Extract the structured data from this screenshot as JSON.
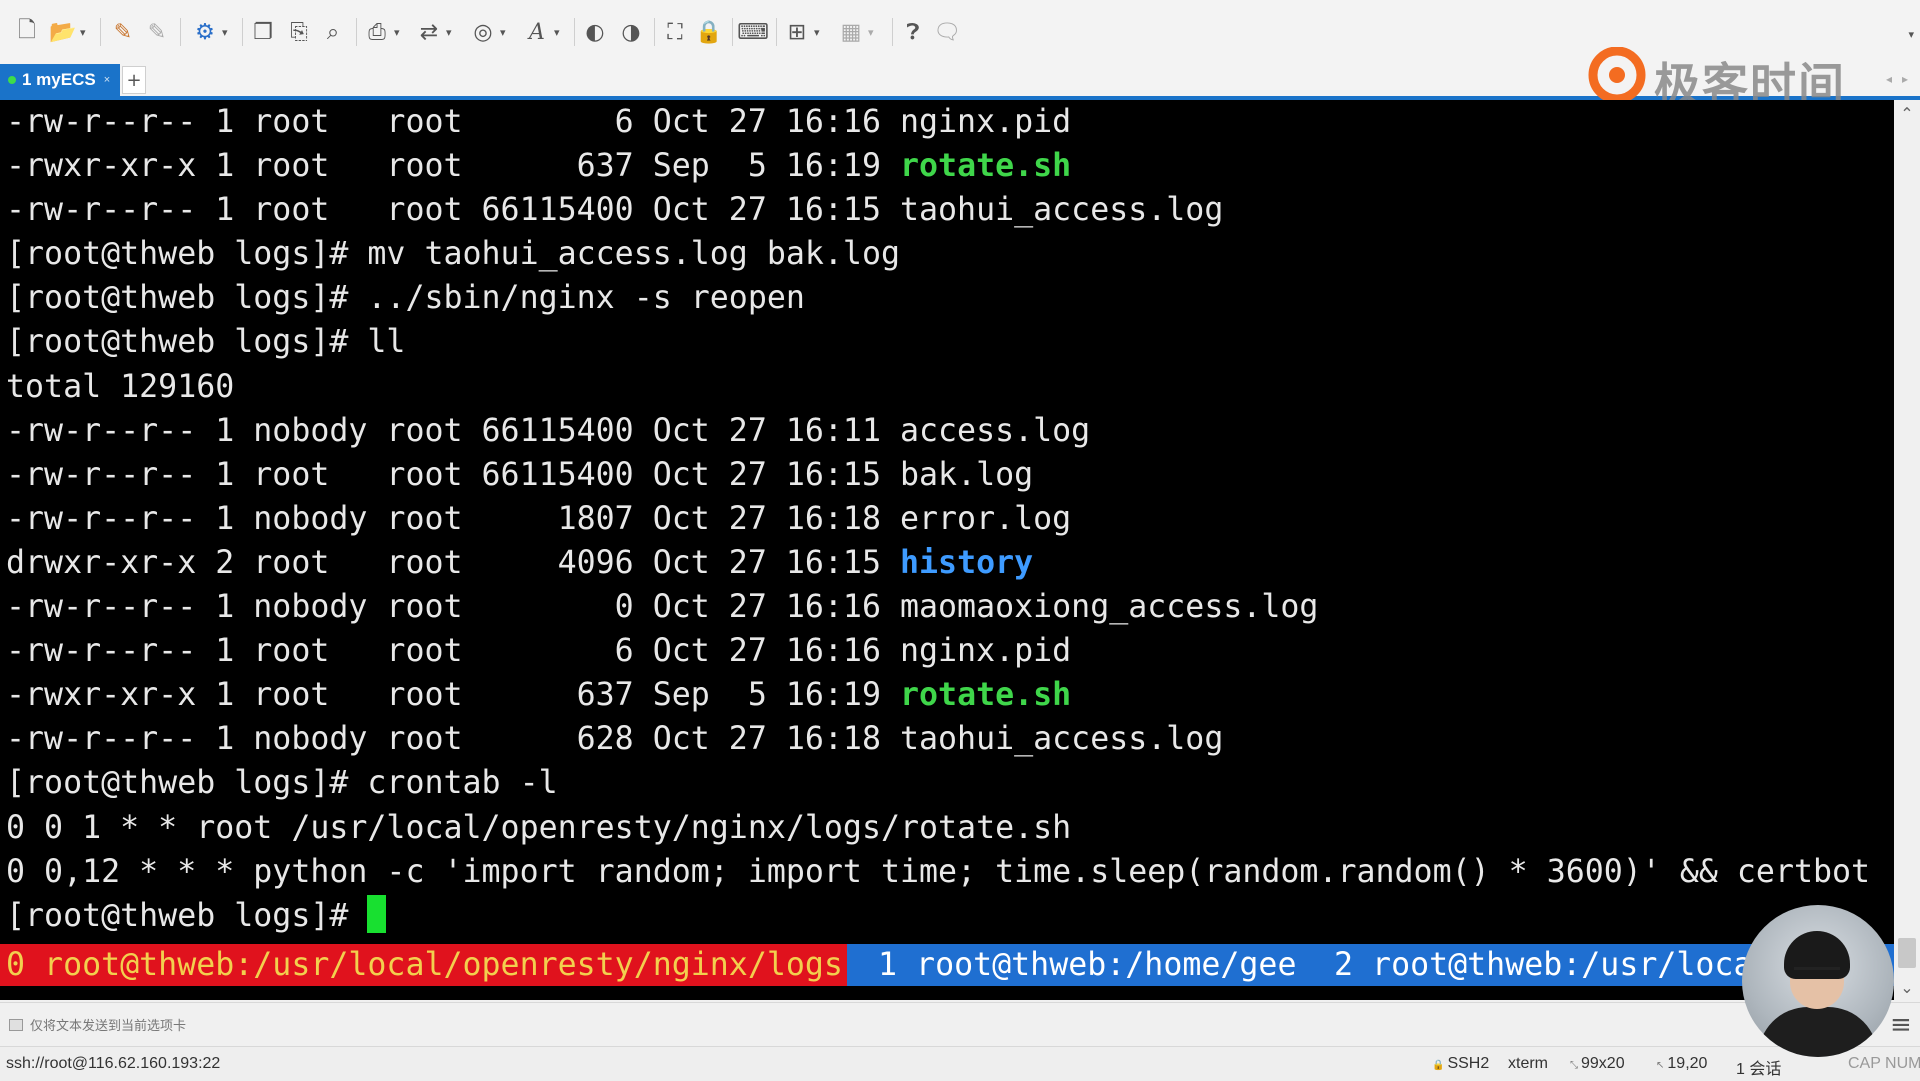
{
  "toolbar": {
    "icons": [
      "new-session-icon",
      "open-folder-icon",
      "connect-icon",
      "disconnect-icon",
      "session-properties-icon",
      "copy-icon",
      "paste-icon",
      "find-icon",
      "print-icon",
      "transfer-icon",
      "globe-icon",
      "font-icon",
      "color-scheme-icon",
      "script-icon",
      "fullscreen-icon",
      "lock-icon",
      "keyboard-icon",
      "new-tab-icon",
      "layout-icon",
      "help-icon",
      "message-icon"
    ]
  },
  "tabs": {
    "active_label": "1 myECS",
    "close_glyph": "×",
    "add_glyph": "+"
  },
  "logo": {
    "text": "极客时间"
  },
  "terminal": {
    "lines": [
      [
        {
          "t": "-rw-r--r-- 1 root   root        6 Oct 27 16:16 nginx.pid"
        }
      ],
      [
        {
          "t": "-rwxr-xr-x 1 root   root      637 Sep  5 16:19 "
        },
        {
          "t": "rotate.sh",
          "c": "green"
        }
      ],
      [
        {
          "t": "-rw-r--r-- 1 root   root 66115400 Oct 27 16:15 taohui_access.log"
        }
      ],
      [
        {
          "t": "[root@thweb logs]# mv taohui_access.log bak.log"
        }
      ],
      [
        {
          "t": "[root@thweb logs]# ../sbin/nginx -s reopen"
        }
      ],
      [
        {
          "t": "[root@thweb logs]# ll"
        }
      ],
      [
        {
          "t": "total 129160"
        }
      ],
      [
        {
          "t": "-rw-r--r-- 1 nobody root 66115400 Oct 27 16:11 access.log"
        }
      ],
      [
        {
          "t": "-rw-r--r-- 1 root   root 66115400 Oct 27 16:15 bak.log"
        }
      ],
      [
        {
          "t": "-rw-r--r-- 1 nobody root     1807 Oct 27 16:18 error.log"
        }
      ],
      [
        {
          "t": "drwxr-xr-x 2 root   root     4096 Oct 27 16:15 "
        },
        {
          "t": "history",
          "c": "blue"
        }
      ],
      [
        {
          "t": "-rw-r--r-- 1 nobody root        0 Oct 27 16:16 maomaoxiong_access.log"
        }
      ],
      [
        {
          "t": "-rw-r--r-- 1 root   root        6 Oct 27 16:16 nginx.pid"
        }
      ],
      [
        {
          "t": "-rwxr-xr-x 1 root   root      637 Sep  5 16:19 "
        },
        {
          "t": "rotate.sh",
          "c": "green"
        }
      ],
      [
        {
          "t": "-rw-r--r-- 1 nobody root      628 Oct 27 16:18 taohui_access.log"
        }
      ],
      [
        {
          "t": "[root@thweb logs]# crontab -l"
        }
      ],
      [
        {
          "t": "0 0 1 * * root /usr/local/openresty/nginx/logs/rotate.sh"
        }
      ],
      [
        {
          "t": "0 0,12 * * * python -c 'import random; import time; time.sleep(random.random() * 3600)' && certbot"
        }
      ]
    ],
    "prompt": "[root@thweb logs]# "
  },
  "tmux": {
    "windows": [
      "0 root@thweb:/usr/local/openresty/nginx/logs",
      "1 root@thweb:/home/gee",
      "2 root@thweb:/usr/local"
    ]
  },
  "sendbar": {
    "text": "仅将文本发送到当前选项卡"
  },
  "status": {
    "connection": "ssh://root@116.62.160.193:22",
    "protocol": "SSH2",
    "term": "xterm",
    "size": "99x20",
    "cursor_pos": "19,20",
    "sessions": "1 会话",
    "keys": "CAP NUM"
  },
  "colors": {
    "terminal_bg": "#000000",
    "terminal_fg": "#e8e8e8",
    "exec_file": "#3fd64a",
    "directory": "#3e9bff",
    "tmux_bg": "#1f6fd1",
    "tmux_active_bg": "#e0121d",
    "tmux_active_fg": "#f2d04e",
    "tab_active": "#1a73c9",
    "logo_orange": "#f36c21"
  }
}
